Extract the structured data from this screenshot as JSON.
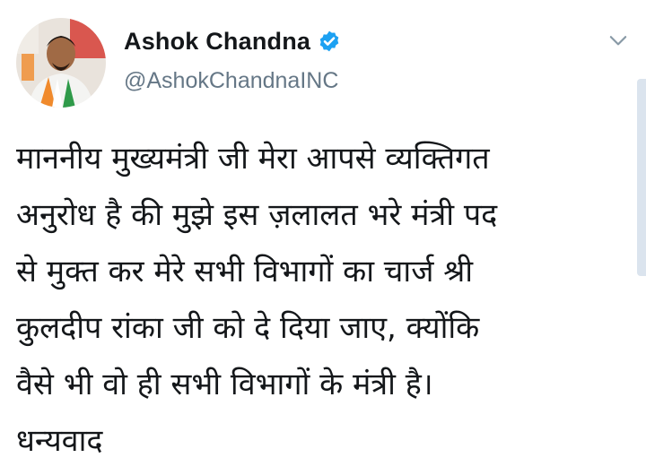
{
  "author": {
    "display_name": "Ashok Chandna",
    "handle": "@AshokChandnaINC",
    "verified": true,
    "avatar": "profile-photo"
  },
  "icons": {
    "verified": "verified-badge-icon",
    "menu": "chevron-down-icon"
  },
  "colors": {
    "verified_badge": "#1da1f2",
    "handle_text": "#657786",
    "body_text": "#14171a"
  },
  "tweet": {
    "lines": [
      "माननीय मुख्यमंत्री जी मेरा आपसे व्यक्तिगत",
      "अनुरोध है की मुझे इस ज़लालत भरे मंत्री पद",
      "से मुक्त कर मेरे सभी विभागों का चार्ज श्री",
      "कुलदीप रांका जी को दे दिया जाए, क्योंकि",
      "वैसे भी वो ही सभी विभागों के मंत्री है।",
      "धन्यवाद"
    ]
  }
}
